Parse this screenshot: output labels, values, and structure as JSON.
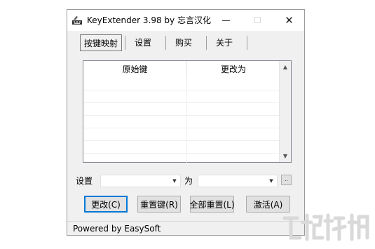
{
  "window": {
    "title": "KeyExtender 3.98 by 忘言汉化",
    "minimize_glyph": "—",
    "maximize_glyph": "☐",
    "close_glyph": "✕"
  },
  "tabs": [
    {
      "label": "按键映射",
      "active": true
    },
    {
      "label": "设置",
      "active": false
    },
    {
      "label": "购买",
      "active": false
    },
    {
      "label": "关于",
      "active": false
    }
  ],
  "mapping_table": {
    "columns": [
      "原始键",
      "更改为"
    ],
    "rows": [
      [
        "",
        ""
      ],
      [
        "",
        ""
      ],
      [
        "",
        ""
      ],
      [
        "",
        ""
      ],
      [
        "",
        ""
      ],
      [
        "",
        ""
      ],
      [
        "",
        ""
      ]
    ]
  },
  "settings_row": {
    "set_label": "设置",
    "to_label": "为",
    "source_value": "",
    "target_value": "",
    "browse_label": ".."
  },
  "buttons": {
    "change": "更改(C)",
    "reset_key": "重置键(R)",
    "reset_all": "全部重置(L)",
    "activate": "激活(A)"
  },
  "status": {
    "text": "Powered by EasySoft"
  },
  "watermark": {
    "icon": "download-site-logo-icon"
  }
}
